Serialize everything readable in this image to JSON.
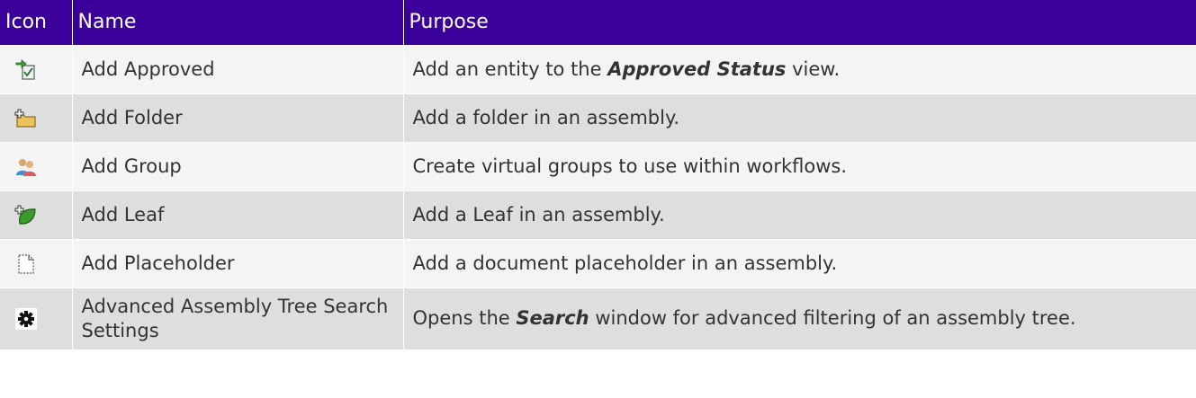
{
  "table": {
    "headers": [
      "Icon",
      "Name",
      "Purpose"
    ],
    "rows": [
      {
        "icon": "add-approved-icon",
        "name": "Add Approved",
        "purpose_before": "Add an entity to the ",
        "purpose_em": "Approved Status",
        "purpose_after": " view."
      },
      {
        "icon": "add-folder-icon",
        "name": "Add Folder",
        "purpose_before": "Add a folder in an assembly.",
        "purpose_em": "",
        "purpose_after": ""
      },
      {
        "icon": "add-group-icon",
        "name": "Add Group",
        "purpose_before": "Create virtual groups to use within workflows.",
        "purpose_em": "",
        "purpose_after": ""
      },
      {
        "icon": "add-leaf-icon",
        "name": "Add Leaf",
        "purpose_before": "Add a Leaf in an assembly.",
        "purpose_em": "",
        "purpose_after": ""
      },
      {
        "icon": "add-placeholder-icon",
        "name": "Add Placeholder",
        "purpose_before": "Add a document placeholder in an assembly.",
        "purpose_em": "",
        "purpose_after": ""
      },
      {
        "icon": "gear-icon",
        "name": "Advanced Assembly Tree Search Settings",
        "purpose_before": "Opens the ",
        "purpose_em": "Search",
        "purpose_after": " window for advanced filtering of an assembly tree."
      }
    ]
  },
  "colors": {
    "header_bg": "#3b0099",
    "row_odd": "#f4f4f4",
    "row_even": "#dedede"
  }
}
